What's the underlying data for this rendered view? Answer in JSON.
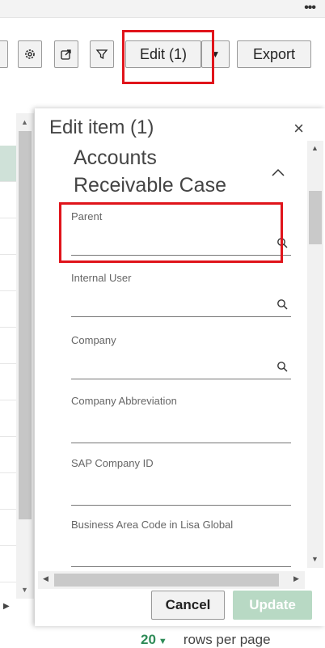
{
  "toolbar": {
    "more_label": "•••",
    "edit_label": "Edit (1)",
    "export_label": "Export"
  },
  "panel": {
    "title": "Edit item (1)",
    "close_label": "×",
    "section_title": "Accounts Receivable Case",
    "collapse_label": "∧",
    "fields": [
      {
        "label": "Parent",
        "value": "",
        "lookup": true
      },
      {
        "label": "Internal User",
        "value": "",
        "lookup": true
      },
      {
        "label": "Company",
        "value": "",
        "lookup": true
      },
      {
        "label": "Company Abbreviation",
        "value": "",
        "lookup": false
      },
      {
        "label": "SAP Company ID",
        "value": "",
        "lookup": false
      },
      {
        "label": "Business Area Code in Lisa Global",
        "value": "",
        "lookup": false
      }
    ],
    "cancel_label": "Cancel",
    "update_label": "Update"
  },
  "pager": {
    "rows_value": "20",
    "rows_label": "rows per page"
  },
  "colors": {
    "highlight": "#e0141b",
    "accent": "#2e8b57",
    "update_disabled": "#b8d9c4",
    "selected_row": "#cfe1d8"
  },
  "icons": [
    "more-icon",
    "settings-gear-icon",
    "share-export-icon",
    "filter-icon",
    "dropdown-caret-icon",
    "close-icon",
    "chevron-up-icon",
    "search-icon"
  ]
}
